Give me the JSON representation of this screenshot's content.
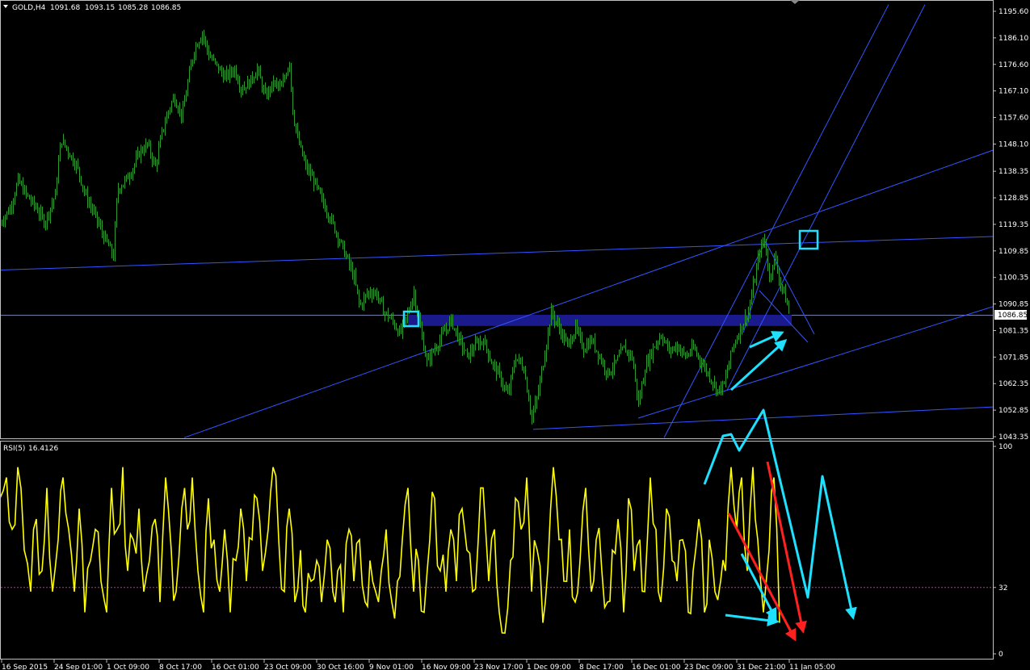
{
  "header": {
    "symbol": "GOLD,H4",
    "open": "1091.68",
    "high": "1093.15",
    "low": "1085.28",
    "close": "1086.85"
  },
  "current_price_label": "1086.85",
  "rsi": {
    "label": "RSI(5)",
    "value": "16.4126",
    "level": 32,
    "scale_labels": [
      "100",
      "32",
      "0"
    ]
  },
  "colors": {
    "background": "#000000",
    "candles": "#2f9a2f",
    "rsi_line": "#ffff00",
    "trendlines": "#3355ff",
    "support_zone": "#1a1a8c",
    "annotation_arrows": "#1ee0ff",
    "divergence_arrows": "#ff2020",
    "rsi_level_line": "#cc3399"
  },
  "icons": {
    "symbol_menu": "triangle-down-icon"
  },
  "chart_data": [
    {
      "type": "candlestick",
      "title": "GOLD,H4",
      "y_ticks": [
        "1195.60",
        "1186.10",
        "1176.60",
        "1167.10",
        "1157.60",
        "1148.10",
        "1138.35",
        "1128.85",
        "1119.35",
        "1109.85",
        "1100.35",
        "1090.85",
        "1081.35",
        "1071.85",
        "1062.35",
        "1052.85",
        "1043.35"
      ],
      "ylim": [
        1043.35,
        1195.6
      ],
      "x_labels": [
        "16 Sep 2015",
        "24 Sep 01:00",
        "1 Oct 09:00",
        "8 Oct 17:00",
        "16 Oct 01:00",
        "23 Oct 09:00",
        "30 Oct 16:00",
        "9 Nov 01:00",
        "16 Nov 09:00",
        "23 Nov 17:00",
        "1 Dec 09:00",
        "8 Dec 17:00",
        "16 Dec 01:00",
        "23 Dec 09:00",
        "31 Dec 21:00",
        "11 Jan 05:00"
      ],
      "x_label_pos": [
        0,
        65,
        130,
        195,
        260,
        325,
        390,
        455,
        520,
        585,
        650,
        715,
        780,
        845,
        910,
        975
      ],
      "price_path": [
        [
          0,
          1120
        ],
        [
          12,
          1125
        ],
        [
          22,
          1135
        ],
        [
          32,
          1130
        ],
        [
          45,
          1125
        ],
        [
          55,
          1120
        ],
        [
          68,
          1130
        ],
        [
          75,
          1150
        ],
        [
          85,
          1145
        ],
        [
          95,
          1140
        ],
        [
          105,
          1130
        ],
        [
          118,
          1122
        ],
        [
          128,
          1115
        ],
        [
          140,
          1108
        ],
        [
          145,
          1132
        ],
        [
          155,
          1135
        ],
        [
          165,
          1140
        ],
        [
          172,
          1145
        ],
        [
          182,
          1148
        ],
        [
          192,
          1140
        ],
        [
          200,
          1152
        ],
        [
          208,
          1160
        ],
        [
          215,
          1165
        ],
        [
          225,
          1158
        ],
        [
          232,
          1170
        ],
        [
          240,
          1182
        ],
        [
          250,
          1188
        ],
        [
          258,
          1180
        ],
        [
          268,
          1176
        ],
        [
          278,
          1172
        ],
        [
          290,
          1175
        ],
        [
          298,
          1168
        ],
        [
          308,
          1170
        ],
        [
          318,
          1175
        ],
        [
          328,
          1165
        ],
        [
          338,
          1170
        ],
        [
          348,
          1168
        ],
        [
          358,
          1178
        ],
        [
          362,
          1160
        ],
        [
          368,
          1150
        ],
        [
          378,
          1140
        ],
        [
          388,
          1135
        ],
        [
          398,
          1128
        ],
        [
          408,
          1122
        ],
        [
          418,
          1115
        ],
        [
          428,
          1108
        ],
        [
          438,
          1100
        ],
        [
          445,
          1090
        ],
        [
          455,
          1095
        ],
        [
          465,
          1095
        ],
        [
          475,
          1088
        ],
        [
          485,
          1085
        ],
        [
          495,
          1080
        ],
        [
          505,
          1088
        ],
        [
          512,
          1095
        ],
        [
          518,
          1085
        ],
        [
          528,
          1070
        ],
        [
          538,
          1075
        ],
        [
          548,
          1080
        ],
        [
          558,
          1085
        ],
        [
          568,
          1078
        ],
        [
          578,
          1072
        ],
        [
          588,
          1076
        ],
        [
          598,
          1078
        ],
        [
          608,
          1070
        ],
        [
          618,
          1065
        ],
        [
          628,
          1058
        ],
        [
          638,
          1072
        ],
        [
          648,
          1068
        ],
        [
          658,
          1050
        ],
        [
          665,
          1058
        ],
        [
          672,
          1070
        ],
        [
          682,
          1088
        ],
        [
          692,
          1082
        ],
        [
          702,
          1076
        ],
        [
          712,
          1082
        ],
        [
          722,
          1075
        ],
        [
          732,
          1078
        ],
        [
          742,
          1072
        ],
        [
          752,
          1066
        ],
        [
          762,
          1070
        ],
        [
          772,
          1075
        ],
        [
          782,
          1072
        ],
        [
          790,
          1055
        ],
        [
          798,
          1068
        ],
        [
          808,
          1075
        ],
        [
          818,
          1080
        ],
        [
          828,
          1074
        ],
        [
          838,
          1076
        ],
        [
          848,
          1072
        ],
        [
          858,
          1075
        ],
        [
          868,
          1070
        ],
        [
          878,
          1065
        ],
        [
          888,
          1060
        ],
        [
          896,
          1062
        ],
        [
          906,
          1075
        ],
        [
          916,
          1082
        ],
        [
          926,
          1088
        ],
        [
          934,
          1100
        ],
        [
          940,
          1110
        ],
        [
          946,
          1114
        ],
        [
          952,
          1100
        ],
        [
          958,
          1108
        ],
        [
          964,
          1100
        ],
        [
          970,
          1095
        ],
        [
          976,
          1088
        ]
      ],
      "annotations": [
        {
          "type": "resistance_line",
          "from": [
            0,
            1103
          ],
          "to": [
            1230,
            1115
          ]
        },
        {
          "type": "horizontal_line",
          "price": 1086.85
        },
        {
          "type": "support_zone",
          "from_x": 505,
          "to_x": 980,
          "top": 1087,
          "bottom": 1083
        },
        {
          "type": "rising_trendline",
          "from": [
            228,
            1043
          ],
          "to": [
            1230,
            1146
          ]
        },
        {
          "type": "rising_trendline",
          "from": [
            790,
            1050
          ],
          "to": [
            1230,
            1090
          ]
        },
        {
          "type": "base_line",
          "from": [
            660,
            1046
          ],
          "to": [
            1230,
            1054
          ]
        },
        {
          "type": "channel_line",
          "from": [
            822,
            1043
          ],
          "to": [
            1100,
            1198
          ]
        },
        {
          "type": "channel_line",
          "from": [
            900,
            1060
          ],
          "to": [
            1145,
            1198
          ]
        }
      ]
    },
    {
      "type": "line",
      "title": "RSI(5) 16.4126",
      "ylim": [
        0,
        100
      ],
      "level": 32,
      "x": [
        0,
        8,
        15,
        22,
        30,
        38,
        45,
        52,
        58,
        65,
        72,
        78,
        85,
        92,
        98,
        105,
        112,
        118,
        125,
        132,
        138,
        145,
        152,
        158,
        165,
        172,
        178,
        185,
        192,
        198,
        205,
        212,
        218,
        225,
        232,
        238,
        245,
        252,
        258,
        265,
        272,
        278,
        285,
        292,
        298,
        305,
        312,
        318,
        325,
        332,
        338,
        345,
        352,
        358,
        365,
        372,
        378,
        385,
        392,
        398,
        405,
        412,
        418,
        425,
        432,
        438,
        445,
        452,
        458,
        465,
        472,
        478,
        485,
        492,
        498,
        505,
        512,
        518,
        525,
        532,
        538,
        545,
        552,
        558,
        565,
        572,
        578,
        585,
        592,
        598,
        605,
        612,
        618,
        625,
        632,
        638,
        645,
        652,
        658,
        665,
        672,
        678,
        685,
        692,
        698,
        705,
        712,
        718,
        725,
        732,
        738,
        745,
        752,
        758,
        765,
        772,
        778,
        785,
        792,
        798,
        805,
        812,
        818,
        825,
        832,
        838,
        845,
        852,
        858,
        865,
        872,
        878,
        885,
        892,
        898,
        905,
        912,
        918,
        925,
        932,
        938,
        945,
        952,
        958,
        965,
        972,
        978
      ],
      "values": [
        75,
        85,
        60,
        90,
        50,
        30,
        65,
        40,
        80,
        30,
        55,
        85,
        60,
        30,
        70,
        20,
        45,
        60,
        35,
        20,
        80,
        60,
        90,
        40,
        55,
        70,
        30,
        45,
        65,
        25,
        85,
        50,
        30,
        70,
        60,
        85,
        40,
        20,
        75,
        55,
        30,
        60,
        20,
        45,
        70,
        35,
        55,
        75,
        40,
        60,
        90,
        55,
        30,
        70,
        25,
        50,
        20,
        35,
        45,
        25,
        55,
        30,
        40,
        20,
        60,
        35,
        55,
        25,
        45,
        30,
        40,
        60,
        25,
        35,
        55,
        80,
        30,
        45,
        20,
        55,
        75,
        40,
        30,
        60,
        35,
        70,
        50,
        30,
        55,
        80,
        35,
        60,
        20,
        10,
        45,
        75,
        60,
        85,
        30,
        50,
        15,
        40,
        90,
        55,
        35,
        60,
        25,
        45,
        80,
        30,
        55,
        40,
        25,
        50,
        65,
        20,
        75,
        40,
        55,
        30,
        85,
        60,
        25,
        70,
        45,
        35,
        55,
        20,
        40,
        65,
        20,
        55,
        30,
        35,
        40,
        90,
        60,
        85,
        40,
        90,
        55,
        20,
        50,
        85,
        15
      ]
    }
  ]
}
